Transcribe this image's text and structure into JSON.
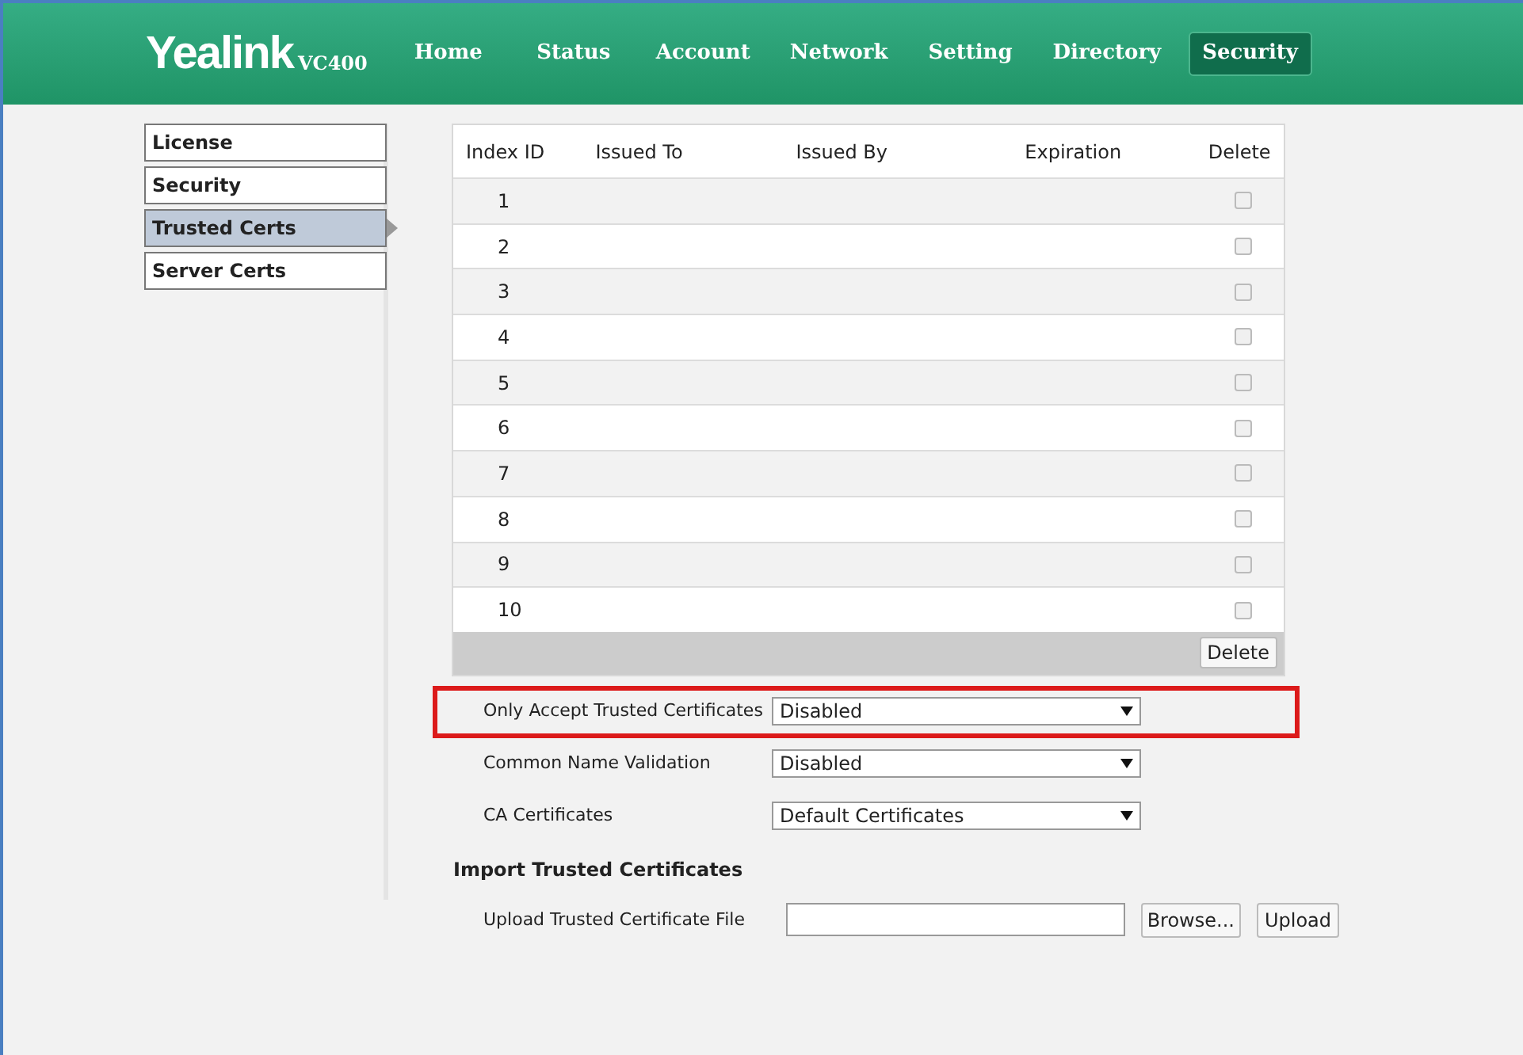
{
  "header": {
    "logo": "Yealink",
    "model": "VC400",
    "nav": [
      {
        "label": "Home",
        "selected": false
      },
      {
        "label": "Status",
        "selected": false
      },
      {
        "label": "Account",
        "selected": false
      },
      {
        "label": "Network",
        "selected": false
      },
      {
        "label": "Setting",
        "selected": false
      },
      {
        "label": "Directory",
        "selected": false
      },
      {
        "label": "Security",
        "selected": true
      }
    ]
  },
  "sidebar": {
    "items": [
      {
        "label": "License",
        "selected": false
      },
      {
        "label": "Security",
        "selected": false
      },
      {
        "label": "Trusted Certs",
        "selected": true
      },
      {
        "label": "Server Certs",
        "selected": false
      }
    ]
  },
  "table": {
    "columns": [
      "Index ID",
      "Issued To",
      "Issued By",
      "Expiration",
      "Delete"
    ],
    "rows": [
      {
        "index": "1",
        "checked": false
      },
      {
        "index": "2",
        "checked": false
      },
      {
        "index": "3",
        "checked": false
      },
      {
        "index": "4",
        "checked": false
      },
      {
        "index": "5",
        "checked": false
      },
      {
        "index": "6",
        "checked": false
      },
      {
        "index": "7",
        "checked": false
      },
      {
        "index": "8",
        "checked": false
      },
      {
        "index": "9",
        "checked": false
      },
      {
        "index": "10",
        "checked": false
      }
    ],
    "delete_button": "Delete"
  },
  "settings": [
    {
      "label": "Only Accept Trusted Certificates",
      "value": "Disabled",
      "highlighted": true
    },
    {
      "label": "Common Name Validation",
      "value": "Disabled",
      "highlighted": false
    },
    {
      "label": "CA Certificates",
      "value": "Default Certificates",
      "highlighted": false
    }
  ],
  "import": {
    "heading": "Import Trusted Certificates",
    "label": "Upload Trusted Certificate File",
    "browse_button": "Browse...",
    "upload_button": "Upload"
  }
}
